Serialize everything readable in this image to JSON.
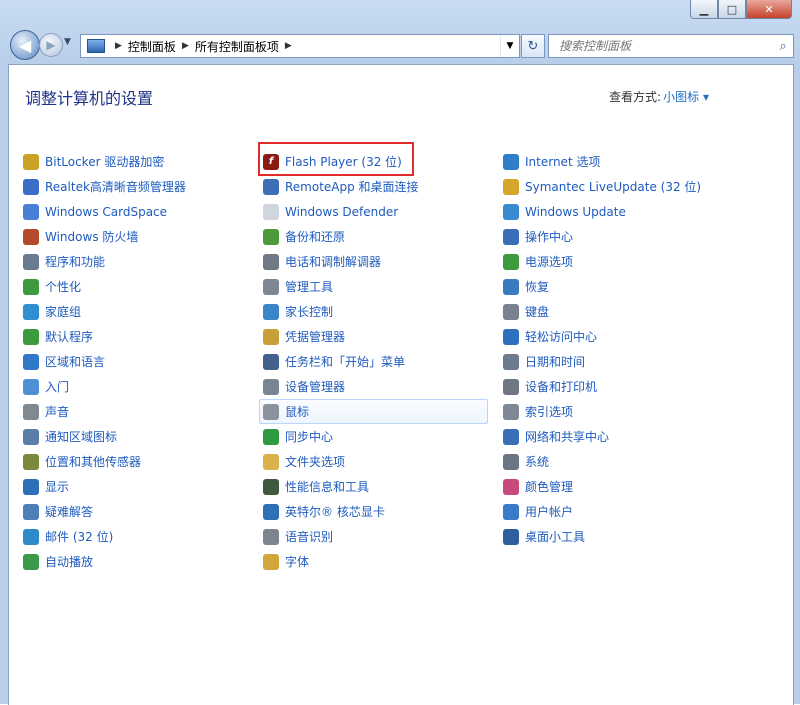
{
  "window": {
    "minimize": "▁",
    "maximize": "□",
    "close": "✕"
  },
  "address": {
    "crumbs": [
      "控制面板",
      "所有控制面板项"
    ]
  },
  "search": {
    "placeholder": "搜索控制面板"
  },
  "page": {
    "title": "调整计算机的设置",
    "viewby_label": "查看方式:",
    "viewby_value": "小图标 ▾"
  },
  "columns": [
    [
      {
        "label": "BitLocker 驱动器加密",
        "icon": "key-icon",
        "color": "#c9a227"
      },
      {
        "label": "Realtek高清晰音频管理器",
        "icon": "speaker-icon",
        "color": "#3b6fc7"
      },
      {
        "label": "Windows CardSpace",
        "icon": "cardspace-icon",
        "color": "#4a7fd8"
      },
      {
        "label": "Windows 防火墙",
        "icon": "firewall-icon",
        "color": "#b54a2a"
      },
      {
        "label": "程序和功能",
        "icon": "programs-icon",
        "color": "#6b7b8f"
      },
      {
        "label": "个性化",
        "icon": "personalize-icon",
        "color": "#3e9a3e"
      },
      {
        "label": "家庭组",
        "icon": "homegroup-icon",
        "color": "#2f8fd0"
      },
      {
        "label": "默认程序",
        "icon": "default-programs-icon",
        "color": "#3c9b3c"
      },
      {
        "label": "区域和语言",
        "icon": "globe-icon",
        "color": "#2f79c8"
      },
      {
        "label": "入门",
        "icon": "getting-started-icon",
        "color": "#4f8fd6"
      },
      {
        "label": "声音",
        "icon": "sound-icon",
        "color": "#808890"
      },
      {
        "label": "通知区域图标",
        "icon": "notification-icon",
        "color": "#5a7ea8"
      },
      {
        "label": "位置和其他传感器",
        "icon": "sensor-icon",
        "color": "#7b8a3a"
      },
      {
        "label": "显示",
        "icon": "display-icon",
        "color": "#2d6fb8"
      },
      {
        "label": "疑难解答",
        "icon": "troubleshoot-icon",
        "color": "#4d7fb9"
      },
      {
        "label": "邮件 (32 位)",
        "icon": "mail-icon",
        "color": "#2e8bc9"
      },
      {
        "label": "自动播放",
        "icon": "autoplay-icon",
        "color": "#3a9a4a"
      }
    ],
    [
      {
        "label": "Flash Player (32 位)",
        "icon": "flash-icon",
        "color": "#8b1a12"
      },
      {
        "label": "RemoteApp 和桌面连接",
        "icon": "remoteapp-icon",
        "color": "#3c6fb5"
      },
      {
        "label": "Windows Defender",
        "icon": "defender-icon",
        "color": "#d0d6de"
      },
      {
        "label": "备份和还原",
        "icon": "backup-icon",
        "color": "#4d9a3a"
      },
      {
        "label": "电话和调制解调器",
        "icon": "phone-modem-icon",
        "color": "#6f7a86"
      },
      {
        "label": "管理工具",
        "icon": "admin-tools-icon",
        "color": "#7d8794"
      },
      {
        "label": "家长控制",
        "icon": "parental-icon",
        "color": "#3a86c8"
      },
      {
        "label": "凭据管理器",
        "icon": "credential-icon",
        "color": "#c8a03a"
      },
      {
        "label": "任务栏和「开始」菜单",
        "icon": "taskbar-icon",
        "color": "#44608c"
      },
      {
        "label": "设备管理器",
        "icon": "device-manager-icon",
        "color": "#7a8593"
      },
      {
        "label": "鼠标",
        "icon": "mouse-icon",
        "color": "#8a929c"
      },
      {
        "label": "同步中心",
        "icon": "sync-icon",
        "color": "#2f9a3f"
      },
      {
        "label": "文件夹选项",
        "icon": "folder-icon",
        "color": "#d9b34a"
      },
      {
        "label": "性能信息和工具",
        "icon": "performance-icon",
        "color": "#3e5a3e"
      },
      {
        "label": "英特尔® 核芯显卡",
        "icon": "intel-icon",
        "color": "#2f6fb5"
      },
      {
        "label": "语音识别",
        "icon": "microphone-icon",
        "color": "#7d8590"
      },
      {
        "label": "字体",
        "icon": "fonts-icon",
        "color": "#d2a63a"
      }
    ],
    [
      {
        "label": "Internet 选项",
        "icon": "internet-icon",
        "color": "#2f7fc8"
      },
      {
        "label": "Symantec LiveUpdate (32 位)",
        "icon": "symantec-icon",
        "color": "#d6a62a"
      },
      {
        "label": "Windows Update",
        "icon": "windows-update-icon",
        "color": "#3a8ad0"
      },
      {
        "label": "操作中心",
        "icon": "action-center-icon",
        "color": "#3a6fb8"
      },
      {
        "label": "电源选项",
        "icon": "power-icon",
        "color": "#3d9a3d"
      },
      {
        "label": "恢复",
        "icon": "recovery-icon",
        "color": "#3a7ac0"
      },
      {
        "label": "键盘",
        "icon": "keyboard-icon",
        "color": "#7a8290"
      },
      {
        "label": "轻松访问中心",
        "icon": "ease-access-icon",
        "color": "#2f6fc0"
      },
      {
        "label": "日期和时间",
        "icon": "clock-icon",
        "color": "#6d7c8c"
      },
      {
        "label": "设备和打印机",
        "icon": "printer-icon",
        "color": "#6f7882"
      },
      {
        "label": "索引选项",
        "icon": "index-icon",
        "color": "#7e8894"
      },
      {
        "label": "网络和共享中心",
        "icon": "network-icon",
        "color": "#3a6fb8"
      },
      {
        "label": "系统",
        "icon": "system-icon",
        "color": "#6b7685"
      },
      {
        "label": "颜色管理",
        "icon": "color-icon",
        "color": "#c84a7a"
      },
      {
        "label": "用户帐户",
        "icon": "user-accounts-icon",
        "color": "#3a7ac8"
      },
      {
        "label": "桌面小工具",
        "icon": "gadgets-icon",
        "color": "#2f5f9f"
      }
    ]
  ]
}
